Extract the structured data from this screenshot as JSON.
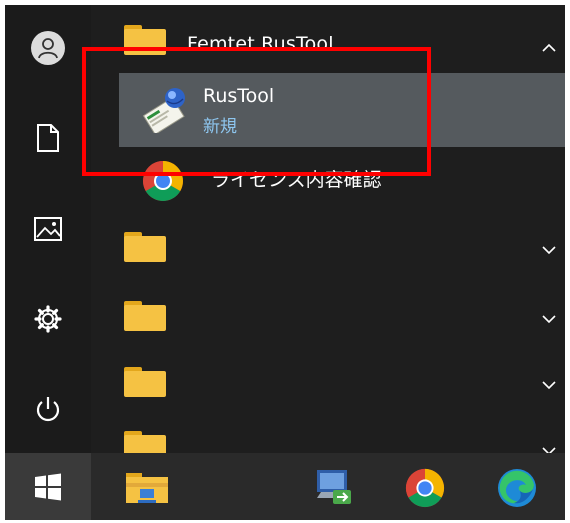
{
  "start_menu": {
    "group": {
      "title": "Femtet RusTool",
      "expanded": true,
      "items": [
        {
          "name": "RusTool",
          "subtitle": "新規",
          "selected": true,
          "icon": "rustool-icon"
        },
        {
          "name": "ライセンス内容確認",
          "icon": "chrome-icon"
        }
      ]
    },
    "collapsed_folders": 4
  },
  "rail": [
    "user-icon",
    "document-icon",
    "pictures-icon",
    "settings-icon",
    "power-icon"
  ],
  "taskbar": {
    "start_icon": "windows-logo-icon",
    "pinned": [
      "file-explorer-icon",
      "remote-desktop-icon",
      "chrome-icon",
      "edge-icon"
    ]
  },
  "colors": {
    "menu_bg": "#1e1e1e",
    "selected_bg": "#555a5e",
    "highlight_border": "#ff0000",
    "subtitle_text": "#8ec6ef",
    "folder_yellow": "#f5c243"
  }
}
